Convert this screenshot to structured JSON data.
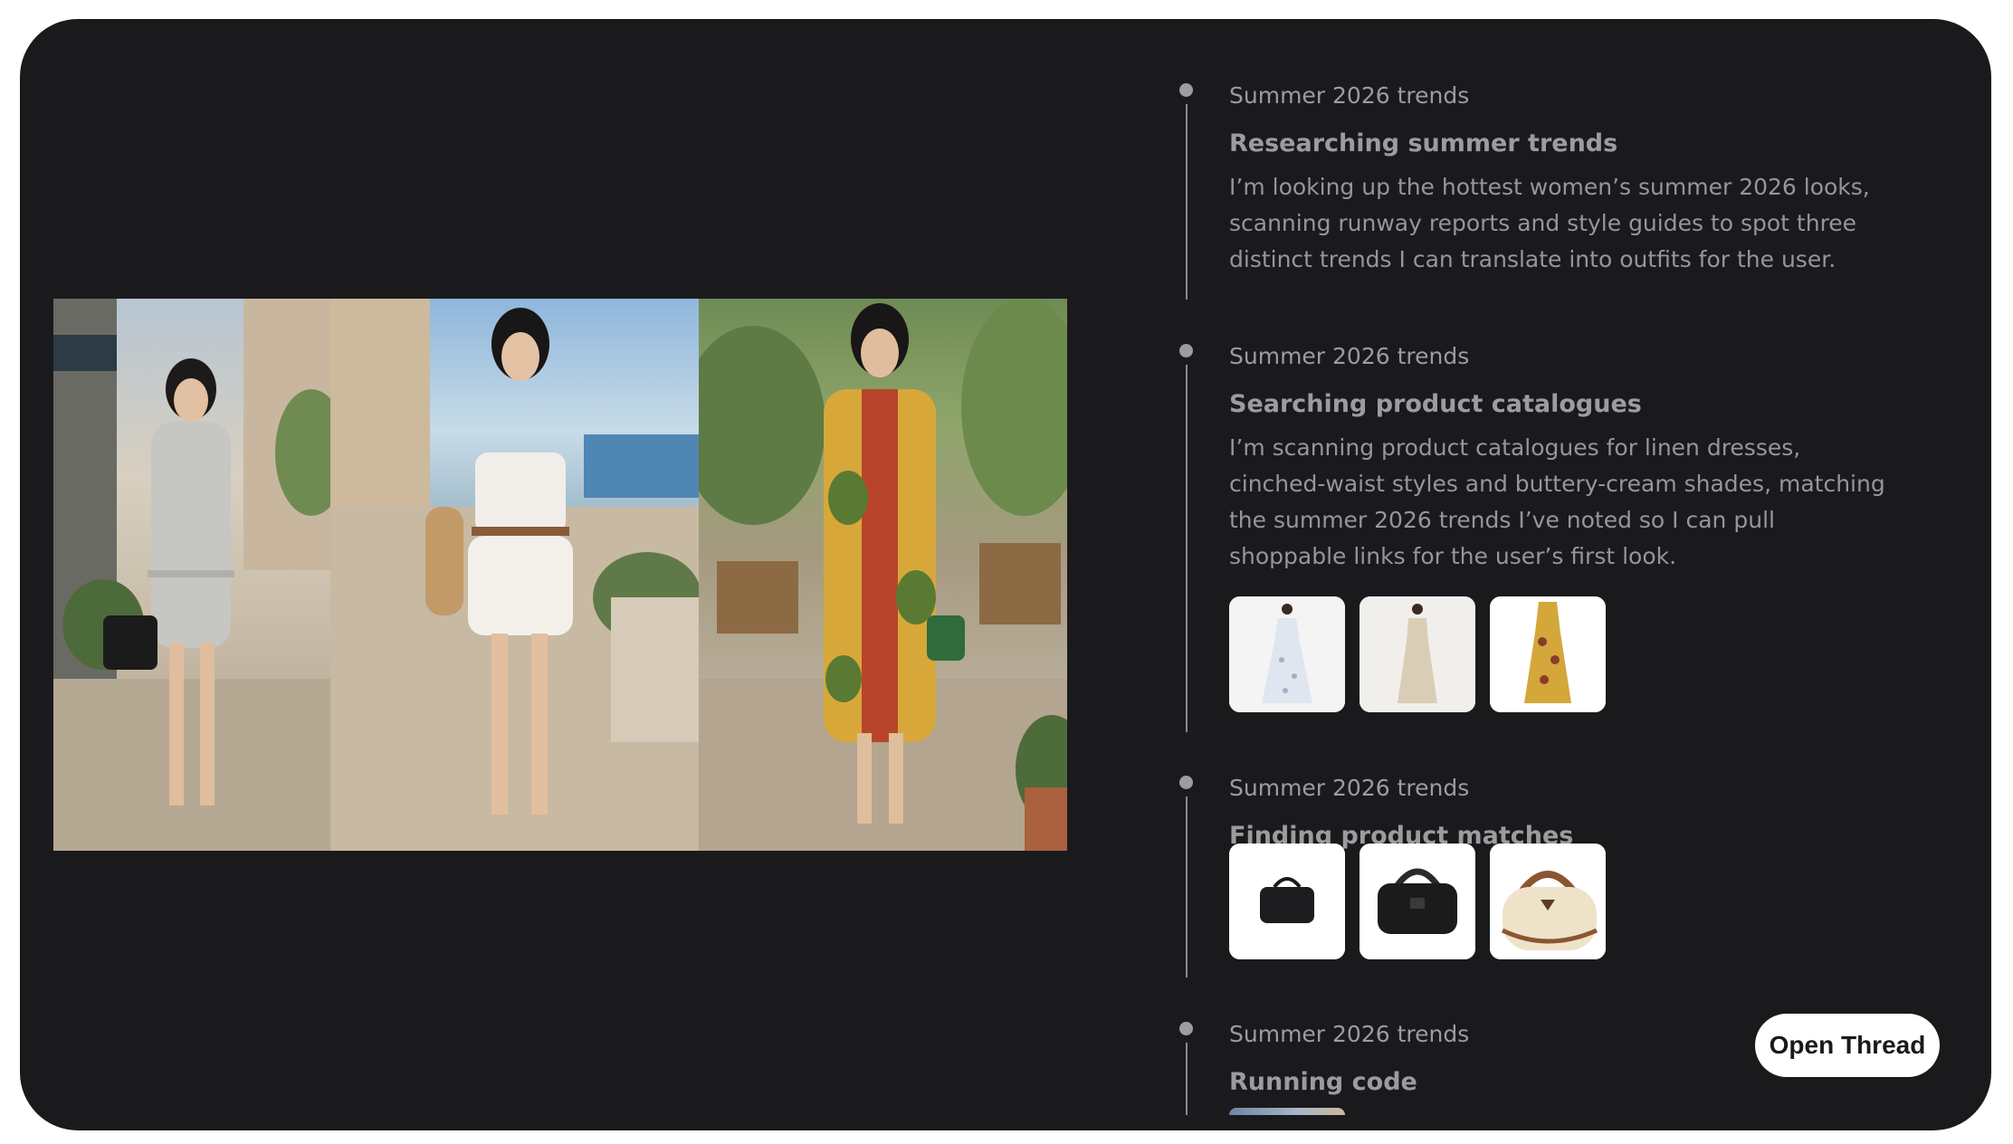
{
  "timeline": {
    "steps": [
      {
        "label": "Summer 2026 trends",
        "title": "Researching summer trends",
        "description": "I’m looking up the hottest women’s summer 2026 looks, scanning runway reports and style guides to spot three distinct trends I can translate into outfits for the user."
      },
      {
        "label": "Summer 2026 trends",
        "title": "Searching product catalogues",
        "description": "I’m scanning product catalogues for linen dresses, cinched-waist styles and buttery-cream shades, matching the summer 2026 trends I’ve noted so I can pull shoppable links for the user’s first look.",
        "thumbnails": [
          "white-floral-maxi-dress",
          "cream-linen-dress",
          "yellow-floral-print-dress"
        ]
      },
      {
        "label": "Summer 2026 trends",
        "title": "Finding product matches",
        "thumbnails": [
          "black-structured-handbag",
          "black-woven-handbag",
          "cream-shearling-handbag"
        ]
      },
      {
        "label": "Summer 2026 trends",
        "title": "Running code"
      }
    ]
  },
  "photo_strip": {
    "photos": [
      "grey-belted-shirtdress-outfit",
      "white-strapless-romper-outfit",
      "printed-shirtdress-outfit"
    ]
  },
  "actions": {
    "open_thread_label": "Open Thread"
  },
  "colors": {
    "card_background": "#1a1a1d",
    "timeline_text": "#9c9c9f",
    "button_background": "#ffffff"
  }
}
